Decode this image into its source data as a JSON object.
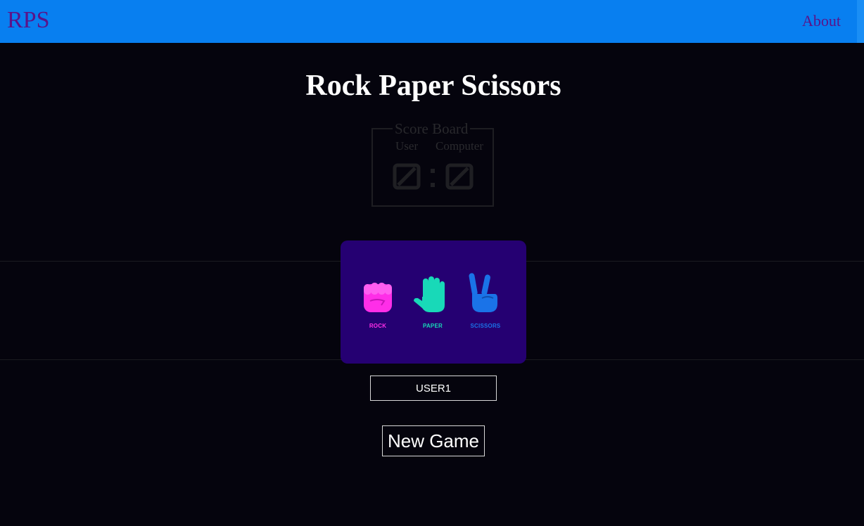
{
  "nav": {
    "brand": "RPS",
    "about_label": "About"
  },
  "title": "Rock Paper Scissors",
  "scoreboard": {
    "legend": "Score Board",
    "user_label": "User",
    "computer_label": "Computer",
    "user_score": "0",
    "computer_score": "0"
  },
  "choices": [
    {
      "label": "ROCK",
      "icon": "rock-fist-icon",
      "color": "#ff2ee8"
    },
    {
      "label": "PAPER",
      "icon": "paper-hand-icon",
      "color": "#18d9b8"
    },
    {
      "label": "SCISSORS",
      "icon": "scissors-hand-icon",
      "color": "#1a73e8"
    }
  ],
  "user_name_field": {
    "value": "USER1"
  },
  "new_game_label": "New Game",
  "colors": {
    "navbar": "#087ff0",
    "nav_text": "#5a138a",
    "background": "#05040d",
    "card": "#250072"
  }
}
